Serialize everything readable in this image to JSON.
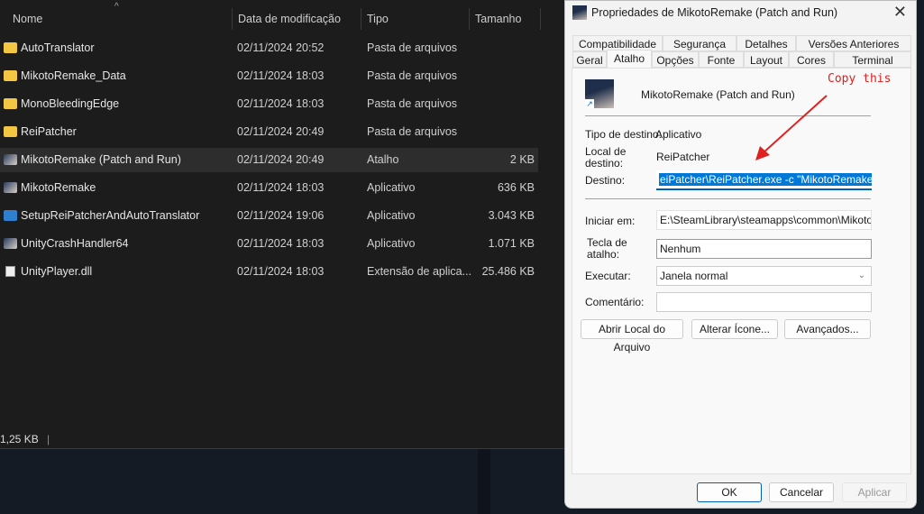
{
  "explorer": {
    "columns": {
      "name": "Nome",
      "date": "Data de modificação",
      "type": "Tipo",
      "size": "Tamanho"
    },
    "files": [
      {
        "name": "AutoTranslator",
        "date": "02/11/2024 20:52",
        "type": "Pasta de arquivos",
        "size": "",
        "icon": "folder"
      },
      {
        "name": "MikotoRemake_Data",
        "date": "02/11/2024 18:03",
        "type": "Pasta de arquivos",
        "size": "",
        "icon": "folder"
      },
      {
        "name": "MonoBleedingEdge",
        "date": "02/11/2024 18:03",
        "type": "Pasta de arquivos",
        "size": "",
        "icon": "folder"
      },
      {
        "name": "ReiPatcher",
        "date": "02/11/2024 20:49",
        "type": "Pasta de arquivos",
        "size": "",
        "icon": "folder"
      },
      {
        "name": "MikotoRemake (Patch and Run)",
        "date": "02/11/2024 20:49",
        "type": "Atalho",
        "size": "2 KB",
        "icon": "app"
      },
      {
        "name": "MikotoRemake",
        "date": "02/11/2024 18:03",
        "type": "Aplicativo",
        "size": "636 KB",
        "icon": "app"
      },
      {
        "name": "SetupReiPatcherAndAutoTranslator",
        "date": "02/11/2024 19:06",
        "type": "Aplicativo",
        "size": "3.043 KB",
        "icon": "setup"
      },
      {
        "name": "UnityCrashHandler64",
        "date": "02/11/2024 18:03",
        "type": "Aplicativo",
        "size": "1.071 KB",
        "icon": "app"
      },
      {
        "name": "UnityPlayer.dll",
        "date": "02/11/2024 18:03",
        "type": "Extensão de aplica...",
        "size": "25.486 KB",
        "icon": "dll"
      }
    ],
    "status": "1,25 KB"
  },
  "dialog": {
    "title": "Propriedades de MikotoRemake (Patch and Run)",
    "tabs_row1": [
      "Compatibilidade",
      "Segurança",
      "Detalhes",
      "Versões Anteriores"
    ],
    "tabs_row2": [
      "Geral",
      "Atalho",
      "Opções",
      "Fonte",
      "Layout",
      "Cores",
      "Terminal"
    ],
    "shortcut_name": "MikotoRemake (Patch and Run)",
    "target_type_label": "Tipo de destino:",
    "target_type": "Aplicativo",
    "target_location_label": "Local de destino:",
    "target_location": "ReiPatcher",
    "target_label": "Destino:",
    "target": "eiPatcher\\ReiPatcher.exe -c \"MikotoRemake.ini\"",
    "start_in_label": "Iniciar em:",
    "start_in": "E:\\SteamLibrary\\steamapps\\common\\MikotoRem",
    "hotkey_label": "Tecla de atalho:",
    "hotkey": "Nenhum",
    "run_label": "Executar:",
    "run": "Janela normal",
    "comment_label": "Comentário:",
    "comment": "",
    "buttons": {
      "open_location": "Abrir Local do Arquivo",
      "change_icon": "Alterar Ícone...",
      "advanced": "Avançados...",
      "ok": "OK",
      "cancel": "Cancelar",
      "apply": "Aplicar"
    }
  },
  "annotation": {
    "text": "Copy this",
    "color": "#e02020"
  }
}
